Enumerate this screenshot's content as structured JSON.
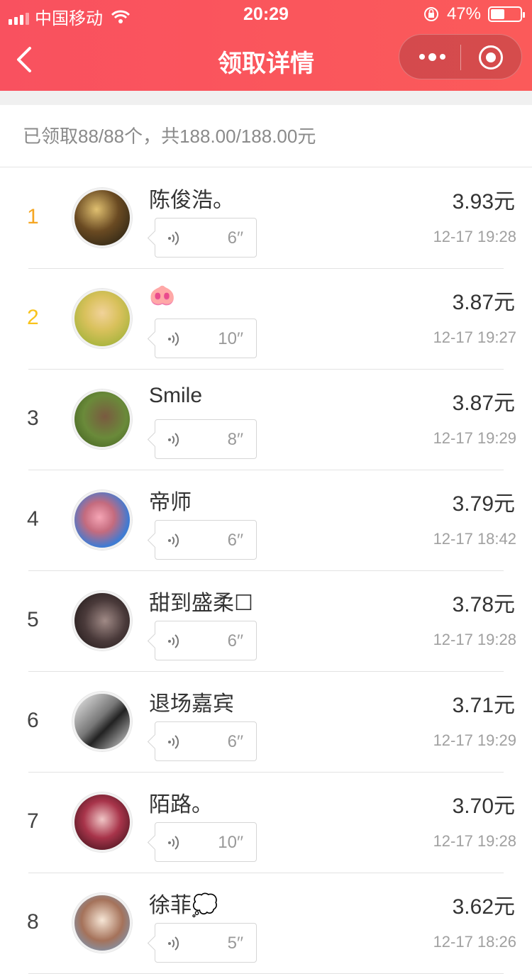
{
  "status_bar": {
    "carrier": "中国移动",
    "time": "20:29",
    "battery_text": "47%",
    "battery_level": 0.47
  },
  "nav": {
    "title": "领取详情",
    "back_icon": "chevron-left-icon",
    "more_icon": "more-dots-icon",
    "close_icon": "target-close-icon"
  },
  "summary": "已领取88/88个，共188.00/188.00元",
  "colors": {
    "header_red": "#f9515f",
    "rank_1": "#f5a623",
    "rank_2": "#f8c31c"
  },
  "records": [
    {
      "rank": "1",
      "name": "陈俊浩。",
      "duration": "6′′",
      "amount": "3.93元",
      "time": "12-17 19:28"
    },
    {
      "rank": "2",
      "name": "🐽",
      "duration": "10′′",
      "amount": "3.87元",
      "time": "12-17 19:27"
    },
    {
      "rank": "3",
      "name": "Smile",
      "duration": "8′′",
      "amount": "3.87元",
      "time": "12-17 19:29"
    },
    {
      "rank": "4",
      "name": "帝师",
      "duration": "6′′",
      "amount": "3.79元",
      "time": "12-17 18:42"
    },
    {
      "rank": "5",
      "name": "甜到盛柔☐",
      "duration": "6′′",
      "amount": "3.78元",
      "time": "12-17 19:28"
    },
    {
      "rank": "6",
      "name": "退场嘉宾",
      "duration": "6′′",
      "amount": "3.71元",
      "time": "12-17 19:29"
    },
    {
      "rank": "7",
      "name": "陌路。",
      "duration": "10′′",
      "amount": "3.70元",
      "time": "12-17 19:28"
    },
    {
      "rank": "8",
      "name": "徐菲💭",
      "duration": "5′′",
      "amount": "3.62元",
      "time": "12-17 18:26"
    }
  ]
}
